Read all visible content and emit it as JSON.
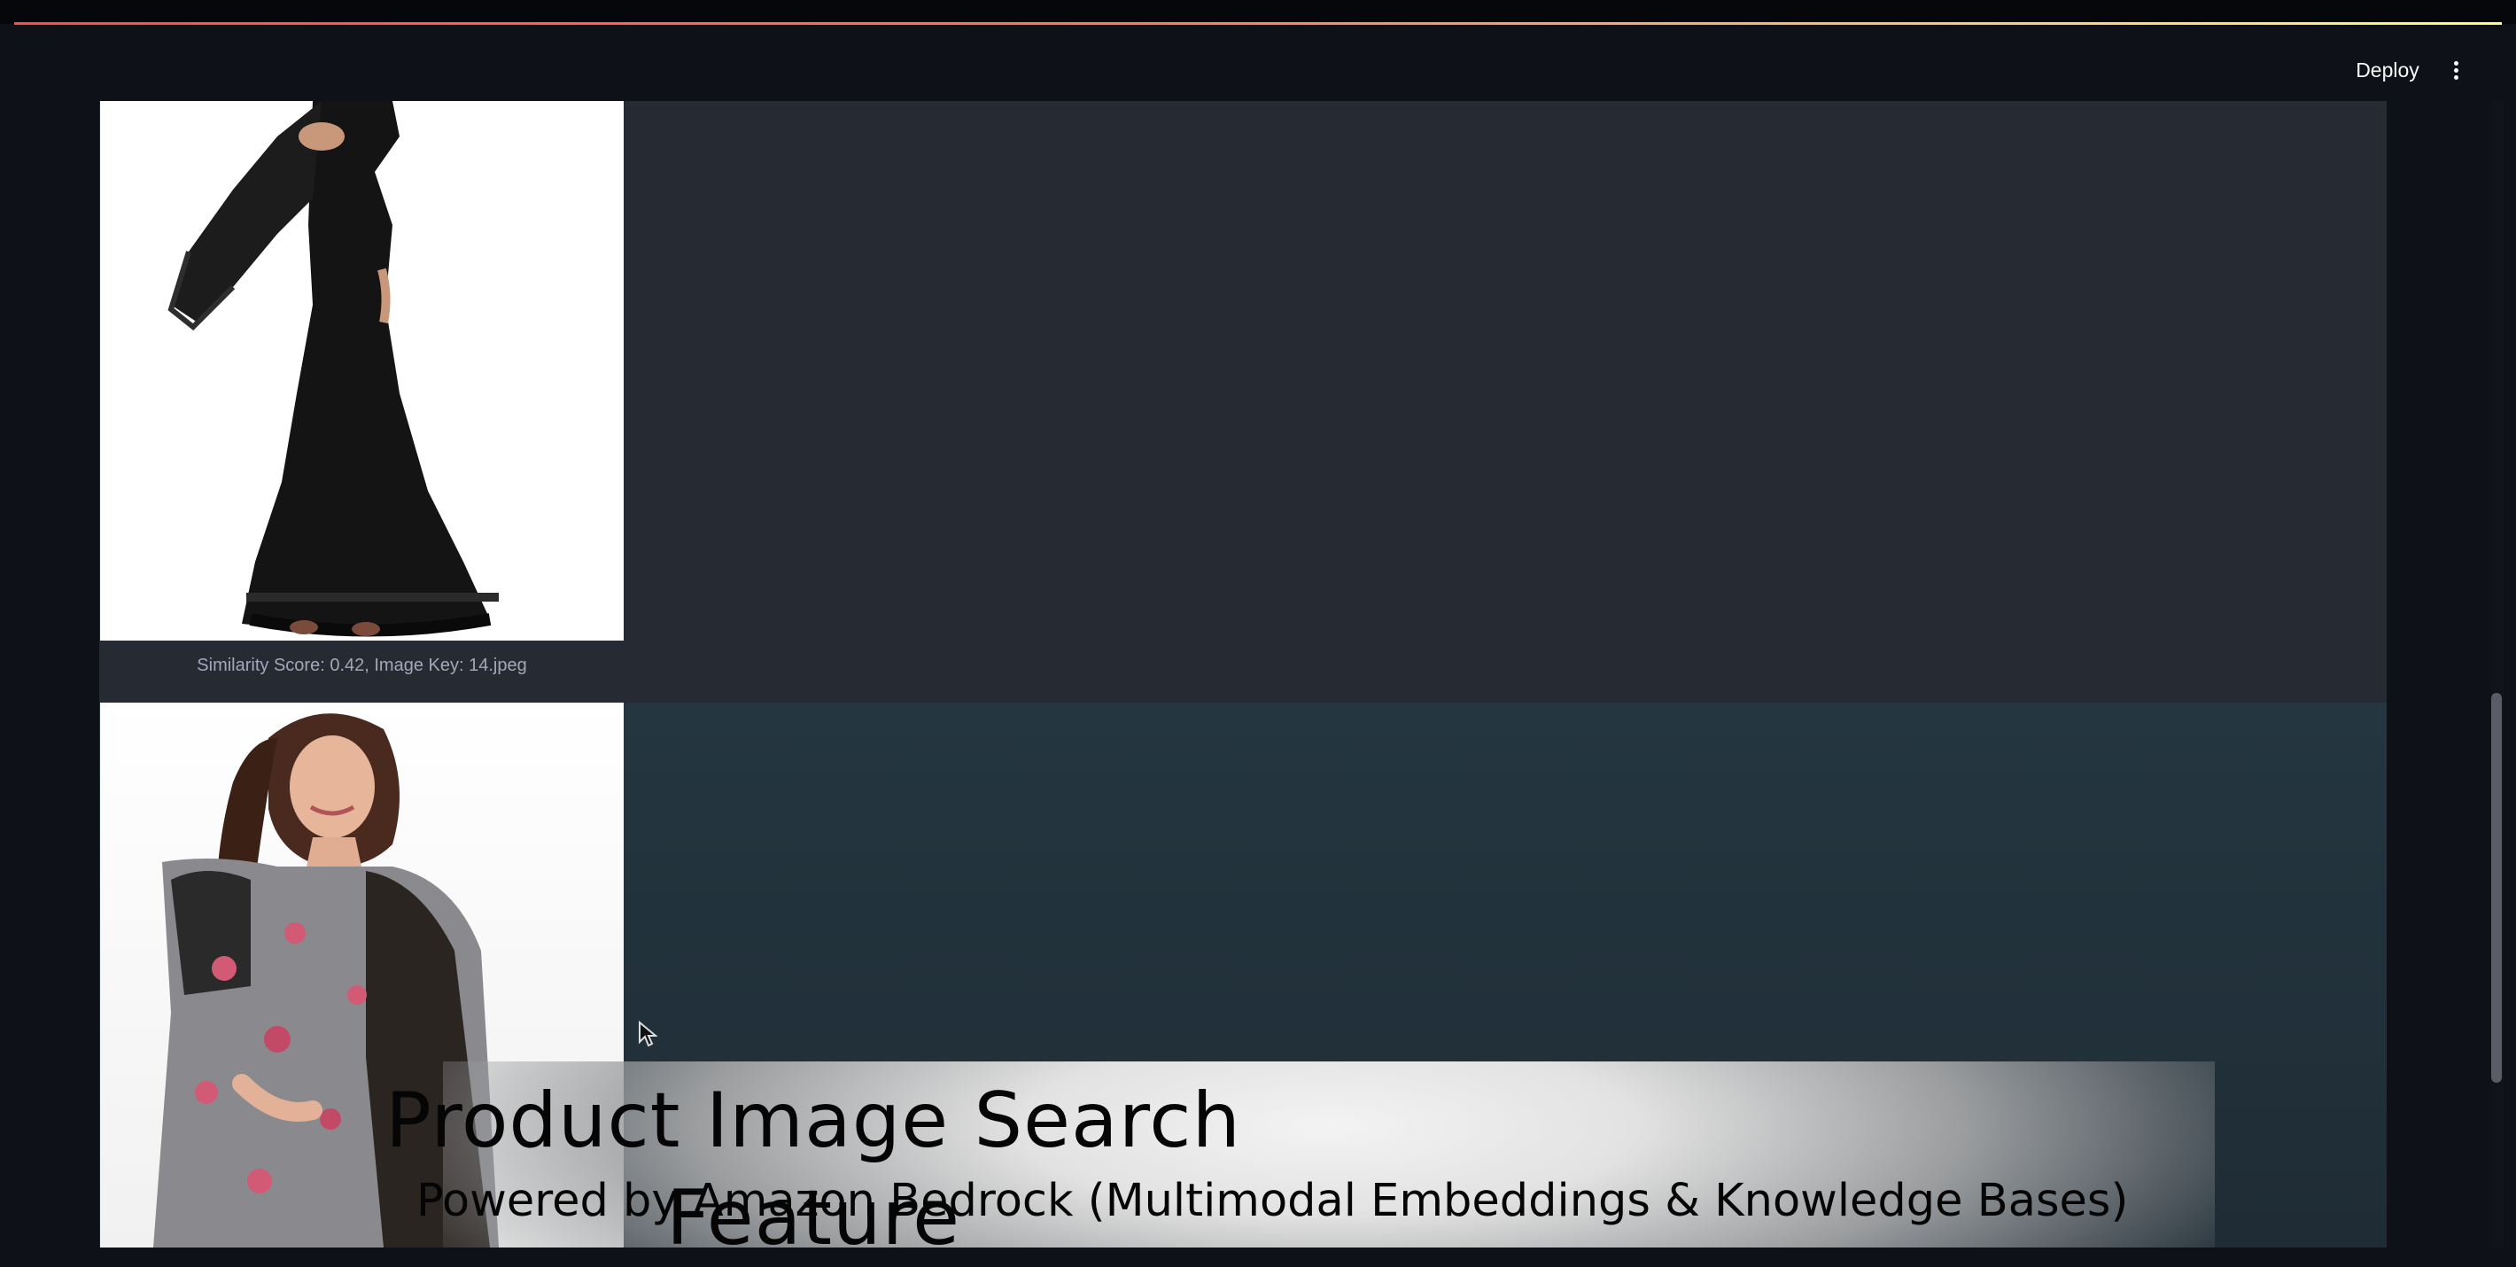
{
  "header": {
    "deploy_label": "Deploy",
    "menu_icon": "vertical-dots-icon"
  },
  "results": [
    {
      "caption": "Similarity Score: 0.42, Image Key: 14.jpeg",
      "image_description": "black-ruffle-saree"
    },
    {
      "caption": "",
      "image_description": "grey-floral-saree"
    }
  ],
  "banner": {
    "title": "Product Image Search Feature",
    "subtitle": "Powered by Amazon Bedrock (Multimodal Embeddings & Knowledge Bases)"
  },
  "colors": {
    "background": "#0e1117",
    "row_1": "#262a33",
    "row_2": "#243640",
    "accent_gradient_start": "#ff4b4b",
    "accent_gradient_end": "#fffd80",
    "caption_text": "#a3a8b8"
  }
}
